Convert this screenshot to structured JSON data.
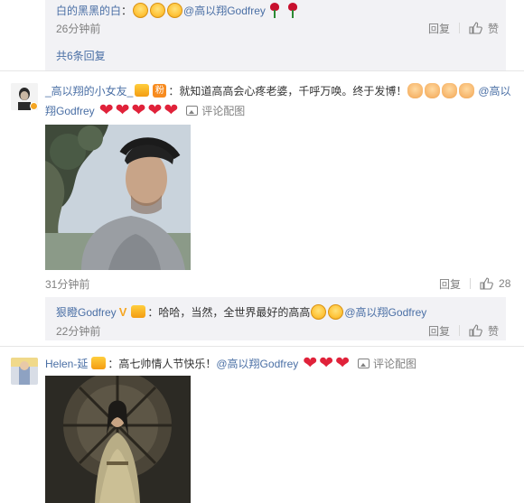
{
  "top_reply": {
    "user": "白的黑黑的白",
    "colon": "：",
    "mention": "@高以翔Godfrey",
    "time": "26分钟前",
    "reply_label": "回复",
    "like_label": "赞",
    "total_replies": "共6条回复"
  },
  "comment1": {
    "user": "_高以翔的小女友_",
    "fan_badge": "粉",
    "text": "：就知道高高会心疼老婆，千呼万唤。终于发博！",
    "mention_line1": "@高以",
    "mention_line2": "翔Godfrey",
    "view_image_label": "评论配图",
    "time": "31分钟前",
    "reply_label": "回复",
    "like_count": "28"
  },
  "comment1_reply": {
    "user": "狠瞪Godfrey",
    "text": "：哈哈，当然，全世界最好的高高",
    "mention": "@高以翔Godfrey",
    "time": "22分钟前",
    "reply_label": "回复",
    "like_label": "赞"
  },
  "comment2": {
    "user": "Helen-延",
    "text": "：高七帅情人节快乐！",
    "mention": "@高以翔Godfrey",
    "view_image_label": "评论配图"
  },
  "icons": [
    "laugh-emoji-icon",
    "rose-icon",
    "heart-icon",
    "victory-hand-icon",
    "thumbs-up-icon",
    "image-icon",
    "vip-badge-icon",
    "verified-v-icon"
  ],
  "colors": {
    "link": "#4a6fa5",
    "muted": "#808080",
    "heart": "#e0223a",
    "reply_bg": "#f2f2f5"
  }
}
